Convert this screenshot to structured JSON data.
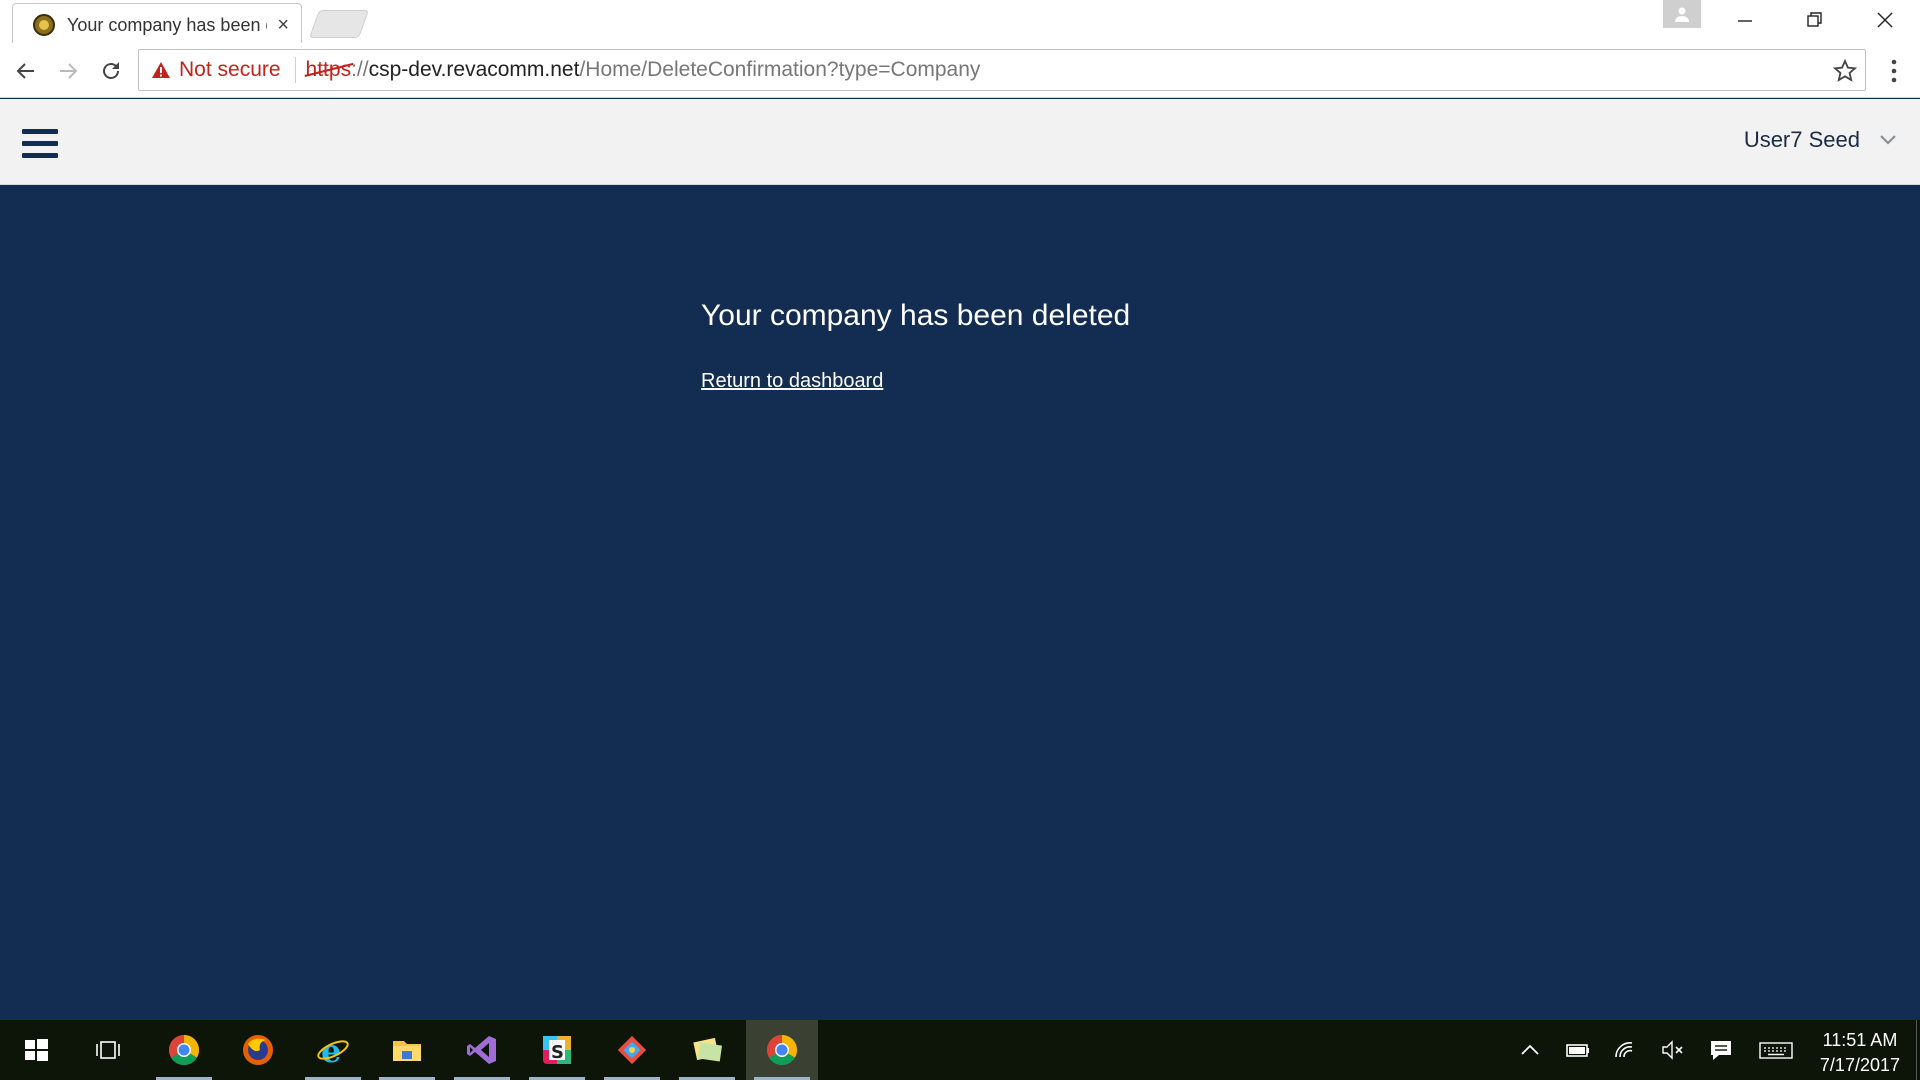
{
  "browser": {
    "tab_title": "Your company has been deleted",
    "tab_close": "×",
    "security_label": "Not secure",
    "url": {
      "scheme": "https",
      "separator": "://",
      "host": "csp-dev.revacomm.net",
      "path": "/Home/DeleteConfirmation?type=Company"
    }
  },
  "header": {
    "user_name": "User7 Seed"
  },
  "main": {
    "message": "Your company has been deleted",
    "return_link": "Return to dashboard"
  },
  "taskbar": {
    "apps": [
      "start",
      "task-view",
      "chrome",
      "firefox",
      "internet-explorer",
      "file-explorer",
      "visual-studio",
      "slack",
      "git-client",
      "sticky-notes",
      "chrome-active"
    ],
    "clock_time": "11:51 AM",
    "clock_date": "7/17/2017"
  },
  "colors": {
    "page_background": "#132c52",
    "header_background": "#f2f2f2",
    "warning_red": "#c5221f",
    "taskbar": "#0c1508"
  }
}
